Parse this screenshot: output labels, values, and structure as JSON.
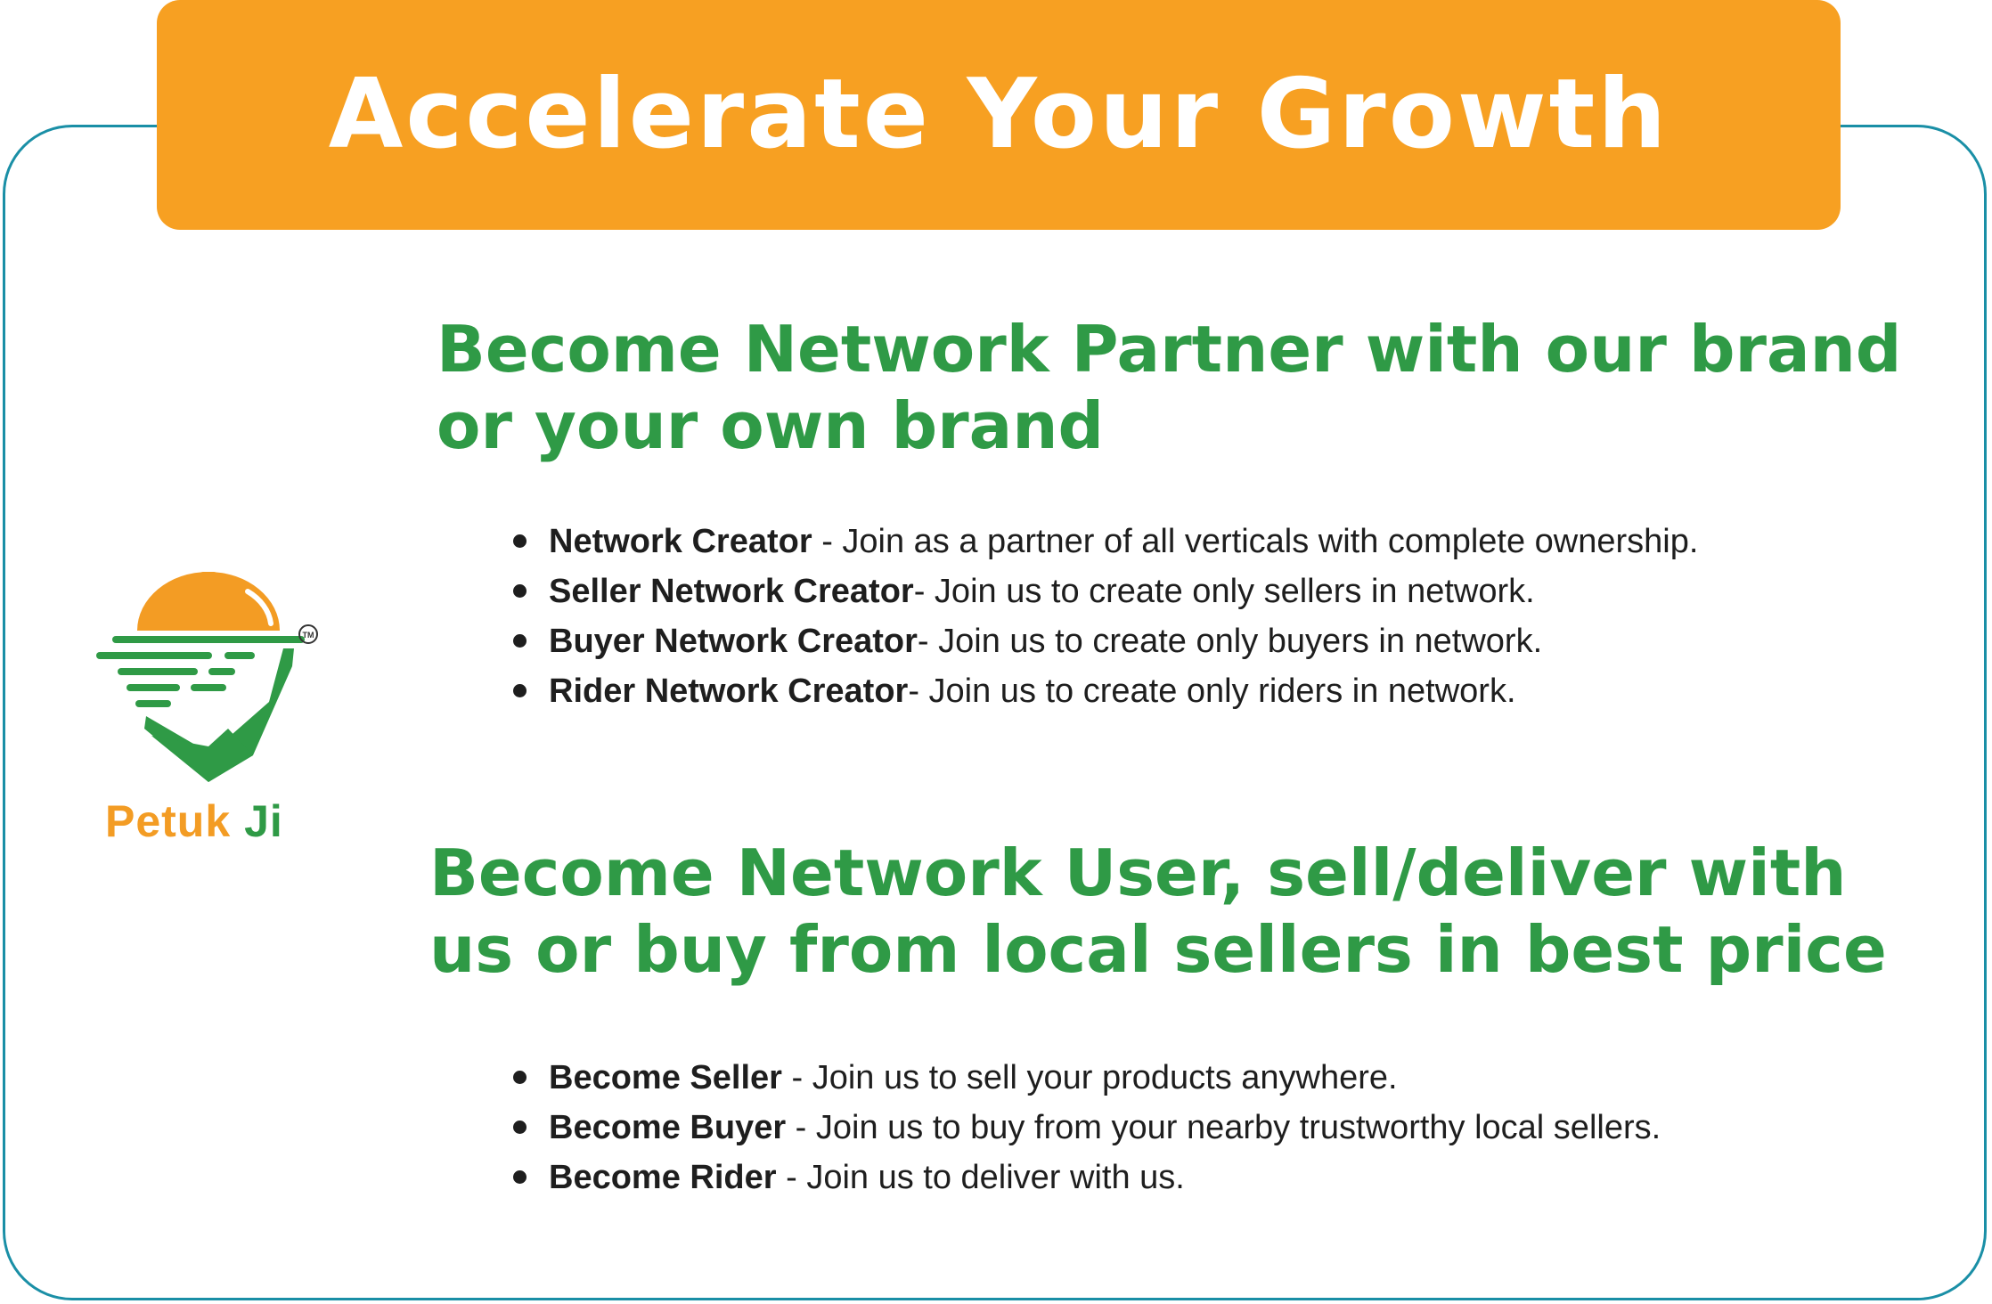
{
  "banner": {
    "title": "Accelerate Your Growth"
  },
  "logo": {
    "brand_first": "Petuk",
    "brand_second": "Ji",
    "trademark": "TM"
  },
  "section1": {
    "heading_line1": "Become Network Partner with our brand",
    "heading_line2": "or your own brand",
    "items": [
      {
        "term": "Network Creator",
        "desc": " - Join as a partner of all verticals with complete ownership."
      },
      {
        "term": "Seller Network Creator",
        "desc": "- Join us to create only sellers in network."
      },
      {
        "term": "Buyer Network Creator",
        "desc": "- Join us to create only buyers in network."
      },
      {
        "term": "Rider Network Creator",
        "desc": "- Join us to create only riders in network."
      }
    ]
  },
  "section2": {
    "heading_line1": "Become Network User, sell/deliver with",
    "heading_line2": "us or buy from local sellers in best price",
    "items": [
      {
        "term": "Become Seller",
        "desc": " - Join us to sell your products anywhere."
      },
      {
        "term": "Become Buyer",
        "desc": " - Join us to buy from your nearby trustworthy local sellers."
      },
      {
        "term": "Become Rider",
        "desc": "  - Join us to deliver with us."
      }
    ]
  },
  "colors": {
    "orange": "#f7a022",
    "green": "#2f9a46",
    "teal_border": "#1a8fa6",
    "text": "#1e1e1e"
  }
}
